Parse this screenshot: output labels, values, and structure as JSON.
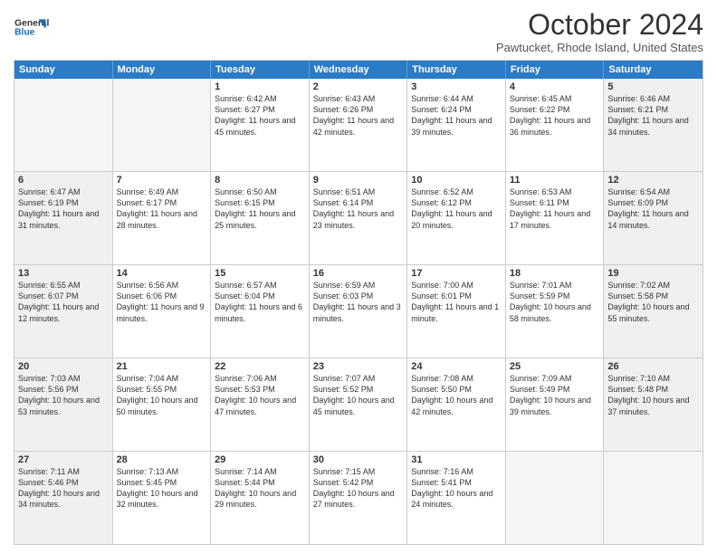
{
  "header": {
    "logo_line1": "General",
    "logo_line2": "Blue",
    "main_title": "October 2024",
    "subtitle": "Pawtucket, Rhode Island, United States"
  },
  "calendar": {
    "days_of_week": [
      "Sunday",
      "Monday",
      "Tuesday",
      "Wednesday",
      "Thursday",
      "Friday",
      "Saturday"
    ],
    "weeks": [
      [
        {
          "day": "",
          "empty": true
        },
        {
          "day": "",
          "empty": true
        },
        {
          "day": "1",
          "sunrise": "6:42 AM",
          "sunset": "6:27 PM",
          "daylight": "11 hours and 45 minutes."
        },
        {
          "day": "2",
          "sunrise": "6:43 AM",
          "sunset": "6:26 PM",
          "daylight": "11 hours and 42 minutes."
        },
        {
          "day": "3",
          "sunrise": "6:44 AM",
          "sunset": "6:24 PM",
          "daylight": "11 hours and 39 minutes."
        },
        {
          "day": "4",
          "sunrise": "6:45 AM",
          "sunset": "6:22 PM",
          "daylight": "11 hours and 36 minutes."
        },
        {
          "day": "5",
          "sunrise": "6:46 AM",
          "sunset": "6:21 PM",
          "daylight": "11 hours and 34 minutes."
        }
      ],
      [
        {
          "day": "6",
          "sunrise": "6:47 AM",
          "sunset": "6:19 PM",
          "daylight": "11 hours and 31 minutes."
        },
        {
          "day": "7",
          "sunrise": "6:49 AM",
          "sunset": "6:17 PM",
          "daylight": "11 hours and 28 minutes."
        },
        {
          "day": "8",
          "sunrise": "6:50 AM",
          "sunset": "6:15 PM",
          "daylight": "11 hours and 25 minutes."
        },
        {
          "day": "9",
          "sunrise": "6:51 AM",
          "sunset": "6:14 PM",
          "daylight": "11 hours and 23 minutes."
        },
        {
          "day": "10",
          "sunrise": "6:52 AM",
          "sunset": "6:12 PM",
          "daylight": "11 hours and 20 minutes."
        },
        {
          "day": "11",
          "sunrise": "6:53 AM",
          "sunset": "6:11 PM",
          "daylight": "11 hours and 17 minutes."
        },
        {
          "day": "12",
          "sunrise": "6:54 AM",
          "sunset": "6:09 PM",
          "daylight": "11 hours and 14 minutes."
        }
      ],
      [
        {
          "day": "13",
          "sunrise": "6:55 AM",
          "sunset": "6:07 PM",
          "daylight": "11 hours and 12 minutes."
        },
        {
          "day": "14",
          "sunrise": "6:56 AM",
          "sunset": "6:06 PM",
          "daylight": "11 hours and 9 minutes."
        },
        {
          "day": "15",
          "sunrise": "6:57 AM",
          "sunset": "6:04 PM",
          "daylight": "11 hours and 6 minutes."
        },
        {
          "day": "16",
          "sunrise": "6:59 AM",
          "sunset": "6:03 PM",
          "daylight": "11 hours and 3 minutes."
        },
        {
          "day": "17",
          "sunrise": "7:00 AM",
          "sunset": "6:01 PM",
          "daylight": "11 hours and 1 minute."
        },
        {
          "day": "18",
          "sunrise": "7:01 AM",
          "sunset": "5:59 PM",
          "daylight": "10 hours and 58 minutes."
        },
        {
          "day": "19",
          "sunrise": "7:02 AM",
          "sunset": "5:58 PM",
          "daylight": "10 hours and 55 minutes."
        }
      ],
      [
        {
          "day": "20",
          "sunrise": "7:03 AM",
          "sunset": "5:56 PM",
          "daylight": "10 hours and 53 minutes."
        },
        {
          "day": "21",
          "sunrise": "7:04 AM",
          "sunset": "5:55 PM",
          "daylight": "10 hours and 50 minutes."
        },
        {
          "day": "22",
          "sunrise": "7:06 AM",
          "sunset": "5:53 PM",
          "daylight": "10 hours and 47 minutes."
        },
        {
          "day": "23",
          "sunrise": "7:07 AM",
          "sunset": "5:52 PM",
          "daylight": "10 hours and 45 minutes."
        },
        {
          "day": "24",
          "sunrise": "7:08 AM",
          "sunset": "5:50 PM",
          "daylight": "10 hours and 42 minutes."
        },
        {
          "day": "25",
          "sunrise": "7:09 AM",
          "sunset": "5:49 PM",
          "daylight": "10 hours and 39 minutes."
        },
        {
          "day": "26",
          "sunrise": "7:10 AM",
          "sunset": "5:48 PM",
          "daylight": "10 hours and 37 minutes."
        }
      ],
      [
        {
          "day": "27",
          "sunrise": "7:11 AM",
          "sunset": "5:46 PM",
          "daylight": "10 hours and 34 minutes."
        },
        {
          "day": "28",
          "sunrise": "7:13 AM",
          "sunset": "5:45 PM",
          "daylight": "10 hours and 32 minutes."
        },
        {
          "day": "29",
          "sunrise": "7:14 AM",
          "sunset": "5:44 PM",
          "daylight": "10 hours and 29 minutes."
        },
        {
          "day": "30",
          "sunrise": "7:15 AM",
          "sunset": "5:42 PM",
          "daylight": "10 hours and 27 minutes."
        },
        {
          "day": "31",
          "sunrise": "7:16 AM",
          "sunset": "5:41 PM",
          "daylight": "10 hours and 24 minutes."
        },
        {
          "day": "",
          "empty": true
        },
        {
          "day": "",
          "empty": true
        }
      ]
    ]
  }
}
